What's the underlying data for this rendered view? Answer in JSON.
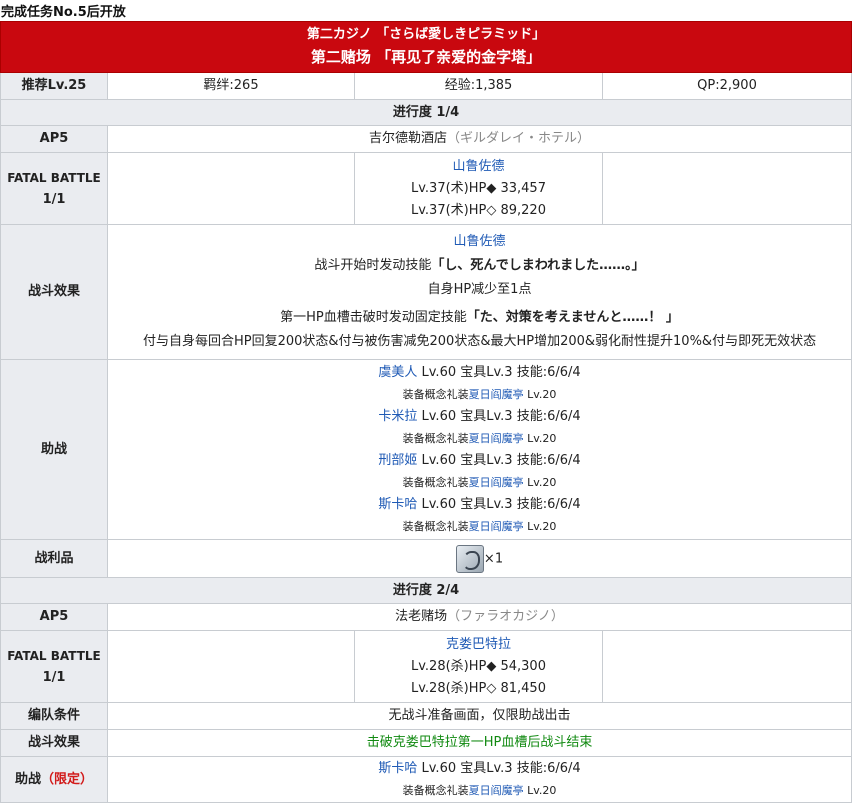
{
  "unlock_condition": "完成任务No.5后开放",
  "quest": {
    "title_jp": "第二カジノ 「さらば愛しきピラミッド」",
    "title_cn": "第二赌场 「再见了亲爱的金字塔」"
  },
  "header_row": {
    "recommend": "推荐Lv.25",
    "bond": "羁绊:265",
    "exp": "经验:1,385",
    "qp": "QP:2,900"
  },
  "stage1": {
    "progress": "进行度 1/4",
    "ap": "AP5",
    "location": "吉尔德勒酒店",
    "location_jp": "（ギルダレイ・ホテル）",
    "fatal_label": "FATAL BATTLE",
    "fatal_count": "1/1",
    "enemy_name": "山鲁佐德",
    "enemy_hp1": "Lv.37(术)HP◆ 33,457",
    "enemy_hp2": "Lv.37(术)HP◇ 89,220",
    "effects_label": "战斗效果",
    "effect_name": "山鲁佐德",
    "effect_line1_prefix": "战斗开始时发动技能",
    "effect_line1_skill": "「し、死んでしまわれました……。」",
    "effect_line2": "自身HP减少至1点",
    "effect_line3_prefix": "第一HP血槽击破时发动固定技能",
    "effect_line3_skill": "「た、対策を考えませんと……！ 」",
    "effect_line4": "付与自身每回合HP回复200状态&付与被伤害减免200状态&最大HP增加200&弱化耐性提升10%&付与即死无效状态",
    "support_label": "助战",
    "supports": [
      {
        "name": "虞美人",
        "stats": " Lv.60 宝具Lv.3 技能:6/6/4",
        "ce_prefix": "装备概念礼装",
        "ce_name": "夏日阎魔亭",
        "ce_lv": " Lv.20"
      },
      {
        "name": "卡米拉",
        "stats": " Lv.60 宝具Lv.3 技能:6/6/4",
        "ce_prefix": "装备概念礼装",
        "ce_name": "夏日阎魔亭",
        "ce_lv": " Lv.20"
      },
      {
        "name": "刑部姬",
        "stats": " Lv.60 宝具Lv.3 技能:6/6/4",
        "ce_prefix": "装备概念礼装",
        "ce_name": "夏日阎魔亭",
        "ce_lv": " Lv.20"
      },
      {
        "name": "斯卡哈",
        "stats": " Lv.60 宝具Lv.3 技能:6/6/4",
        "ce_prefix": "装备概念礼装",
        "ce_name": "夏日阎魔亭",
        "ce_lv": " Lv.20"
      }
    ],
    "drop_label": "战利品",
    "drop_icon": "serpent-jewel-icon",
    "drop_count": "×1"
  },
  "stage2": {
    "progress": "进行度 2/4",
    "ap": "AP5",
    "location": "法老赌场",
    "location_jp": "（ファラオカジノ）",
    "fatal_label": "FATAL BATTLE",
    "fatal_count": "1/1",
    "enemy_name": "克娄巴特拉",
    "enemy_hp1": "Lv.28(杀)HP◆ 54,300",
    "enemy_hp2": "Lv.28(杀)HP◇ 81,450",
    "formation_label": "编队条件",
    "formation_text": "无战斗准备画面，仅限助战出击",
    "effects_label": "战斗效果",
    "effect_text": "击破克娄巴特拉第一HP血槽后战斗结束",
    "support_label": "助战",
    "support_limited": "（限定）",
    "support": {
      "name": "斯卡哈",
      "stats": " Lv.60 宝具Lv.3 技能:6/6/4",
      "ce_prefix": "装备概念礼装",
      "ce_name": "夏日阎魔亭",
      "ce_lv": " Lv.20"
    }
  }
}
